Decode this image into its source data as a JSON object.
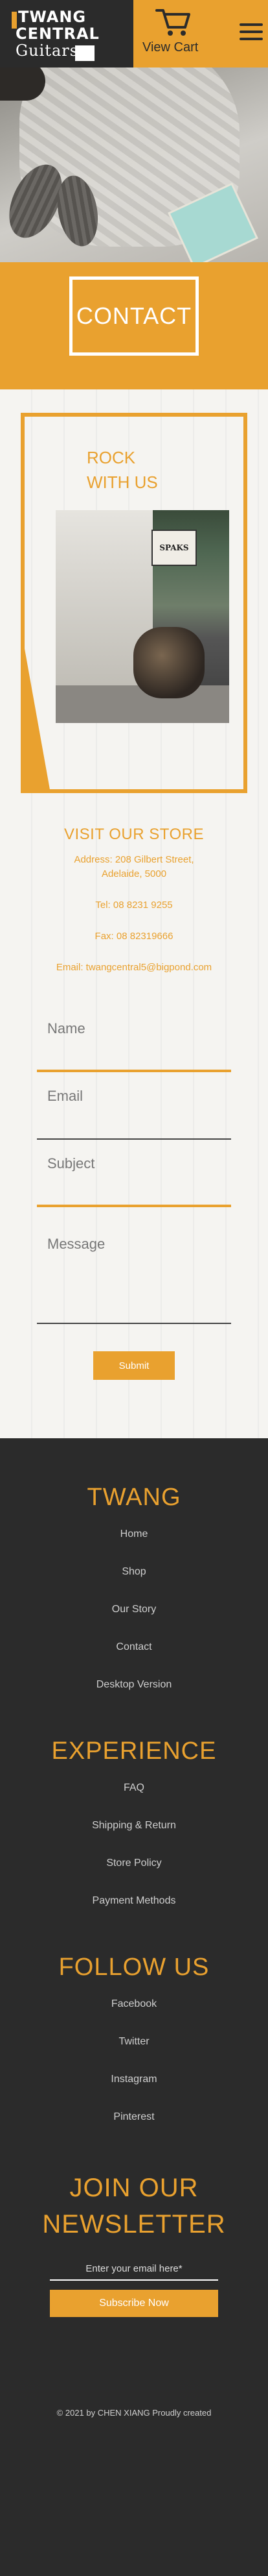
{
  "header": {
    "logo": {
      "line1": "TWANG",
      "line2": "CENTRAL",
      "line3": "Guitars"
    },
    "cart_label": "View Cart",
    "icons": {
      "cart": "cart-icon",
      "menu": "hamburger-menu-icon"
    }
  },
  "banner": {
    "title": "CONTACT"
  },
  "rock": {
    "line1": "ROCK",
    "line2": "WITH US",
    "photo_sign": "SPAKS"
  },
  "visit": {
    "title": "VISIT OUR STORE",
    "address_line1": "Address: 208 Gilbert Street,",
    "address_line2": "Adelaide, 5000",
    "tel": "Tel: 08 8231 9255",
    "fax": "Fax: 08 82319666",
    "email": "Email: twangcentral5@bigpond.com"
  },
  "form": {
    "name_placeholder": "Name",
    "email_placeholder": "Email",
    "subject_placeholder": "Subject",
    "message_placeholder": "Message",
    "submit_label": "Submit"
  },
  "footer": {
    "twang": {
      "title": "TWANG",
      "links": [
        "Home",
        "Shop",
        "Our Story",
        "Contact",
        "Desktop Version"
      ]
    },
    "experience": {
      "title": "EXPERIENCE",
      "links": [
        "FAQ",
        "Shipping & Return",
        "Store Policy",
        "Payment Methods"
      ]
    },
    "follow": {
      "title": "FOLLOW US",
      "links": [
        "Facebook",
        "Twitter",
        "Instagram",
        "Pinterest"
      ]
    },
    "newsletter": {
      "title_line1": "JOIN OUR",
      "title_line2": "NEWSLETTER",
      "email_placeholder": "Enter your email here*",
      "subscribe_label": "Subscribe Now"
    },
    "copyright": "© 2021 by CHEN XIANG Proudly created"
  },
  "colors": {
    "accent": "#e9a12f",
    "dark": "#2b2b2b",
    "light_bg": "#f5f4f1"
  }
}
